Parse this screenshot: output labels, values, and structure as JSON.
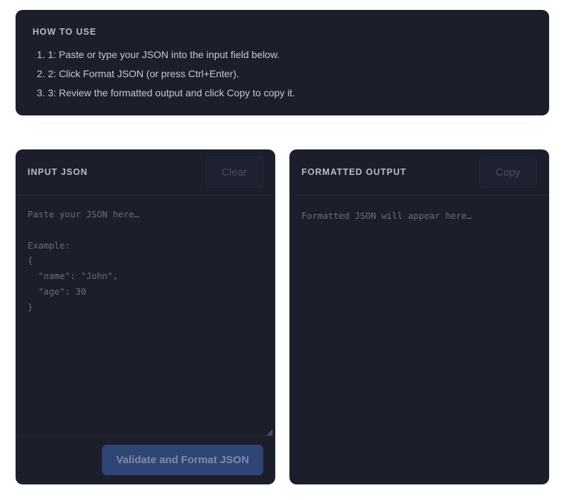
{
  "how_to": {
    "title": "HOW TO USE",
    "steps": [
      "1. 1: Paste or type your JSON into the input field below.",
      "2. 2: Click Format JSON (or press Ctrl+Enter).",
      "3. 3: Review the formatted output and click Copy to copy it."
    ]
  },
  "input_panel": {
    "title": "INPUT JSON",
    "clear_label": "Clear",
    "value": "",
    "placeholder": "Paste your JSON here…\n\nExample:\n{\n  \"name\": \"John\",\n  \"age\": 30\n}",
    "submit_label": "Validate and Format JSON"
  },
  "output_panel": {
    "title": "FORMATTED OUTPUT",
    "copy_label": "Copy",
    "placeholder": "Formatted JSON will appear here…"
  },
  "colors": {
    "panel_bg": "#1c1f2b",
    "primary_button": "#2f4576",
    "divider": "#fcf6fc"
  }
}
